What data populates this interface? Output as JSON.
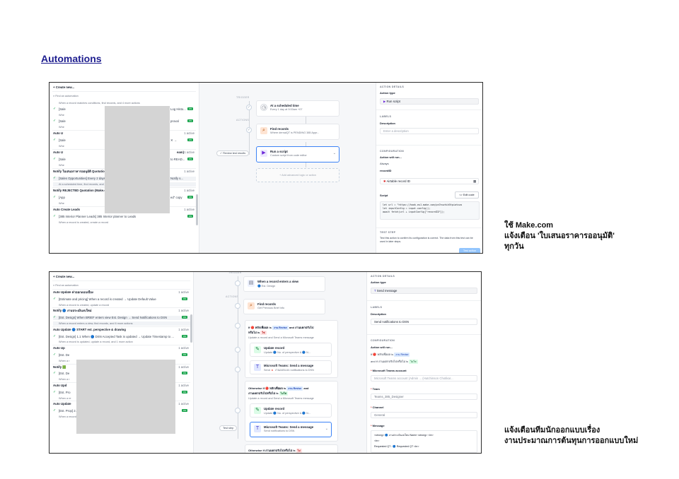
{
  "page": {
    "title": "Automations",
    "caption1": [
      "ใช้ Make.com",
      "แจ้งเตือน 'ใบเสนอราคารออนุมัติ'",
      "ทุกวัน"
    ],
    "caption2": [
      "แจ้งเตือนทีมนักออกแบบเรื่อง",
      "งานประมาณการต้นทุนการออกแบบใหม่"
    ]
  },
  "colors": {
    "on_badge": "#16a34a",
    "selected_border": "#3b82f6",
    "title_link": "#1d1d8f"
  },
  "shot1": {
    "list": {
      "create": "Create new...",
      "find": "Find an automation",
      "rows": [
        {
          "kind": "sub",
          "text": "When a record matches conditions, find records, and 4 more actions"
        },
        {
          "kind": "item",
          "text": "[Sale",
          "tail": "Log Histo...",
          "badge": "ON"
        },
        {
          "kind": "sub",
          "text": "Whe"
        },
        {
          "kind": "item",
          "text": "[Sale",
          "tail": "proval",
          "badge": "ON"
        },
        {
          "kind": "sub",
          "text": "Whe"
        },
        {
          "kind": "hdr",
          "text": "Auto U",
          "act": "1 active"
        },
        {
          "kind": "item",
          "text": "[Sale",
          "tail": "✕ →",
          "badge": "ON"
        },
        {
          "kind": "sub",
          "text": "Whe"
        },
        {
          "kind": "hdr",
          "text": "Auto U",
          "tail": "eam)",
          "act": "1 active"
        },
        {
          "kind": "item",
          "text": "[Sale",
          "tail": "to READ...",
          "badge": "ON"
        },
        {
          "kind": "sub",
          "text": "Whe"
        },
        {
          "kind": "hdr",
          "text": "Notify ใบเสนอราคารออนุมัติ Quotation (Make.com)",
          "act": "1 active"
        },
        {
          "kind": "sel",
          "text": "[Sales Opportunities] Every 2 days 9:00am → Find PENDING 385 Approvals QT & Notify s..."
        },
        {
          "kind": "subsel",
          "text": "At a scheduled time, find records, and 1 more action"
        },
        {
          "kind": "hdr",
          "text": "Notify REJECTED Quotation (Make.com)",
          "act": "1 active"
        },
        {
          "kind": "item",
          "text": "[App",
          "tail": "ed\" copy",
          "badge": "ON"
        },
        {
          "kind": "sub",
          "text": "Whe"
        },
        {
          "kind": "hdr",
          "text": "Auto Create Leads",
          "act": "1 active"
        },
        {
          "kind": "item",
          "text": "[385 Interior Planner Leads] 385 Interior planner to Leads",
          "badge": "ON"
        },
        {
          "kind": "sub",
          "text": "When a record is created, create a record"
        }
      ]
    },
    "flow": {
      "trigger_label": "TRIGGER",
      "actions_label": "ACTIONS",
      "review": "Review test results",
      "nodes": [
        {
          "title": "At a scheduled time",
          "sub": "Every 1 day at 9:00am +07"
        },
        {
          "title": "Find records",
          "sub": "Where dernaiQT is PENDING 385 Appr..."
        },
        {
          "title": "Run a script",
          "sub": "Custom script from code editor"
        }
      ],
      "add": "+ Add advanced logic or action"
    },
    "details": {
      "section": "ACTION DETAILS",
      "type_label": "Action type",
      "type_value": "Run script",
      "labels_cap": "LABELS",
      "desc_label": "Description",
      "desc_ph": "Enter a description",
      "config_cap": "CONFIGURATION",
      "will_run": "Action will run...",
      "always": "Always",
      "record_label": "recordID",
      "record_value": "Airtable record ID",
      "script_label": "Script",
      "edit_code": "<> Edit code",
      "code": [
        "let url = \"https://hook.eu1.make.com/pn7euzhih5tpiatcws",
        "let inputConfig = input.config();",
        "await fetch(url + inputConfig[\"recordID\"]);"
      ],
      "test_cap": "TEST STEP",
      "test_text": "Test this action to confirm its configuration is correct. The data from this test can be used in later steps.",
      "test_btn": "Test action"
    }
  },
  "shot2": {
    "list": {
      "create": "Create new...",
      "find": "Find an automation",
      "rows": [
        {
          "kind": "hdr",
          "text": "Auto Update ค่าออกแบบเบื้อง",
          "act": "1 active"
        },
        {
          "kind": "item",
          "text": "[Estimate and pricing] When a record is created → Update Default Value",
          "badge": "ON"
        },
        {
          "kind": "sub",
          "text": "When a record is created, update a record"
        },
        {
          "kind": "hdr",
          "text": "Notify 🔵 งานประเมินงบใหม่",
          "act": "1 active"
        },
        {
          "kind": "sel",
          "text": "[Est. Design] When BRIEF enters view Est. Design → Send Notifications to DSN",
          "badge": "ON"
        },
        {
          "kind": "subsel",
          "text": "When a record enters a view, find records, and 6 more actions"
        },
        {
          "kind": "hdr",
          "text": "Auto Update 🔵 START est. perspective & drawing",
          "act": "1 active"
        },
        {
          "kind": "item",
          "text": "[Est. Design] 1.1 When 🔵 DSN Accepted Task is updated → Update Timestamp to ...",
          "badge": "ON"
        },
        {
          "kind": "sub",
          "text": "When a record is updated, update a record, and 1 more action"
        },
        {
          "kind": "hdr",
          "text": "Auto Up",
          "act": "1 active"
        },
        {
          "kind": "item",
          "text": "[Est. De",
          "badge": "ON"
        },
        {
          "kind": "sub",
          "text": "When a r"
        },
        {
          "kind": "hdr",
          "text": "Notify 🟩",
          "act": "1 active"
        },
        {
          "kind": "item",
          "text": "[Est. De",
          "badge": "ON"
        },
        {
          "kind": "sub",
          "text": "When a r"
        },
        {
          "kind": "hdr",
          "text": "Auto Upd",
          "act": "1 active"
        },
        {
          "kind": "item",
          "text": "[Est. Pro",
          "badge": "ON"
        },
        {
          "kind": "sub",
          "text": "When a re"
        },
        {
          "kind": "hdr",
          "text": "Auto Update",
          "act": "1 active"
        },
        {
          "kind": "item",
          "text": "[Est. Prop] 2.2 When 🟩 Attach Cost Prop is updated → Update Timestamp to 🟩 D...",
          "badge": "ON"
        },
        {
          "kind": "sub",
          "text": "When a record is updated, update a record"
        }
      ]
    },
    "flow": {
      "trigger_label": "TRIGGER",
      "actions_label": "ACTIONS",
      "test_step": "Test step",
      "nodes": [
        {
          "title": "When a record enters a view",
          "sub": "🔵 Est. Design"
        },
        {
          "title": "Find records",
          "sub": "Get Previous Brief info"
        }
      ],
      "branch1": {
        "cond_pre": "If 🔴 หลักเพื่อผล is",
        "chip1": "งาน Revise",
        "cond_mid": "and งานแตกปรับไป",
        "cond_mid2": "หรือไม่ is",
        "chip2": "ใช่",
        "sub": "Update a record and Send a Microsoft Teams message",
        "items": [
          {
            "title": "Update record",
            "sub": "Update 🔵 No. of perspective & 🔵 N..."
          },
          {
            "title": "Microsoft Teams: Send a message",
            "sub": "Send 🔺 งานออกแบบ notifications to DSN"
          }
        ]
      },
      "branch2": {
        "cond_pre": "Otherwise if 🔴 หลักเพื่อผล is",
        "chip1": "งาน Revise",
        "cond_mid": "and",
        "cond_mid2": "งานแตกปรับไปหรือไม่ is",
        "chip2": "ไม่ใช่",
        "sub": "Update a record and Send a Microsoft Teams message",
        "items": [
          {
            "title": "Update record",
            "sub": "Update 🔵 No. of perspective & 🔵 N..."
          },
          {
            "title": "Microsoft Teams: Send a message",
            "sub": "Send notifications to DSN"
          }
        ]
      },
      "branch3": {
        "cond_pre": "Otherwise if งานแตกปรับไปหรือไม่ is",
        "chip1": "ไม่"
      }
    },
    "details": {
      "section": "ACTION DETAILS",
      "type_label": "Action type",
      "type_value": "Send message",
      "labels_cap": "LABELS",
      "desc_label": "Description",
      "desc_value": "Send notifications to DSN",
      "config_cap": "CONFIGURATION",
      "will_run": "Action will run...",
      "cond1_pre": "If 🔴 หลักเพื่อผล is",
      "cond1_chip": "งาน Revise",
      "cond2_pre": "and if งานแตกปรับไปหรือไม่ is",
      "cond2_chip": "ไม่ใช่",
      "account_label": "Microsoft Teams account",
      "account_value": "Microsoft Teams account (Admin ... (Hutchinson Chotikar...",
      "team_label": "Team",
      "team_value": "Teams_385_Designer",
      "channel_label": "Channel",
      "channel_value": "General",
      "message_label": "Message",
      "message_line1": "<strong> 🔵 งานประเมินงบใหม่    Name    <strong> <br>",
      "message_line2": "<br>",
      "message_line3": "Requested QT :    🔵 Requested QT    <br>"
    }
  }
}
